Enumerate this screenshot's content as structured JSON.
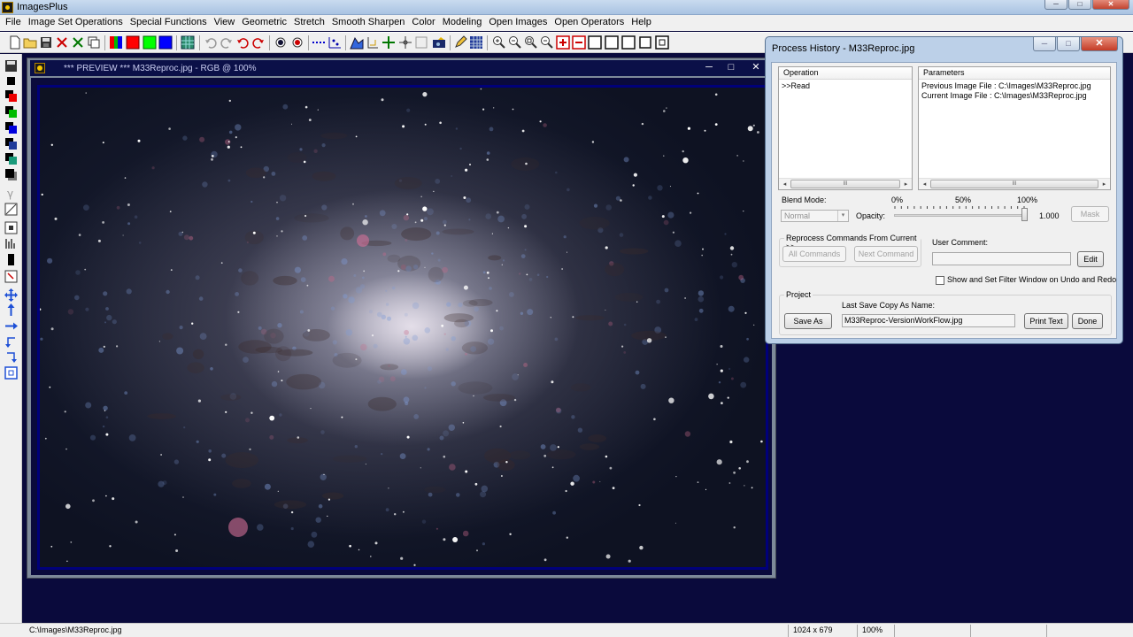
{
  "app": {
    "title": "ImagesPlus"
  },
  "window_buttons": {
    "minimize": "─",
    "maximize": "□",
    "close": "✕"
  },
  "menu": [
    "File",
    "Image Set Operations",
    "Special Functions",
    "View",
    "Geometric",
    "Stretch",
    "Smooth Sharpen",
    "Color",
    "Modeling",
    "Open Images",
    "Open Operators",
    "Help"
  ],
  "toolbar_icons": [
    "new-icon",
    "open-icon",
    "save-icon",
    "close-image-icon",
    "close-all-icon",
    "copy-icon",
    "rgb-channels-icon",
    "red-channel-icon",
    "green-channel-icon",
    "blue-channel-icon",
    "grid-icon",
    "undo-icon",
    "redo-icon",
    "undo-red-icon",
    "redo-red-icon",
    "point-icon",
    "point-red-icon",
    "dotted-line-icon",
    "plot-icon",
    "histogram-icon",
    "axes-icon",
    "crosshair-icon",
    "star-icon",
    "camera-icon",
    "pencil-icon",
    "table-icon",
    "zoom-in-icon",
    "zoom-out-icon",
    "zoom-fit-icon",
    "zoom-actual-icon",
    "plus-box-icon",
    "minus-box-icon",
    "box1-icon",
    "box2-icon",
    "box3-icon",
    "box4-icon",
    "box5-icon"
  ],
  "left_toolbar_icons": [
    "save-icon",
    "black-swatch-icon",
    "red-swatch-icon",
    "green-swatch-icon",
    "blue-swatch-icon",
    "dark-blue-swatch-icon",
    "teal-swatch-icon",
    "shadow-swatch-icon",
    "gamma-icon",
    "curve-icon",
    "frame-icon",
    "levels-icon",
    "bar-icon",
    "crop-icon",
    "move-icon",
    "arrow-up-icon",
    "arrow-right-icon",
    "rotate-left-icon",
    "rotate-right-icon",
    "fit-icon"
  ],
  "preview": {
    "title": "*** PREVIEW *** M33Reproc.jpg - RGB @ 100%",
    "btn_min": "─",
    "btn_max": "□",
    "btn_close": "✕"
  },
  "dialog": {
    "title": "Process History - M33Reproc.jpg",
    "operation_header": "Operation",
    "operations": [
      ">>Read"
    ],
    "parameters_header": "Parameters",
    "parameters": [
      "Previous Image File : C:\\Images\\M33Reproc.jpg",
      "Current Image File : C:\\Images\\M33Reproc.jpg"
    ],
    "scroll_left": "◂",
    "scroll_right": "▸",
    "scroll_grip": "III",
    "blend_mode_label": "Blend Mode:",
    "blend_mode_value": "Normal",
    "combo_arrow": "▾",
    "opacity_label": "Opacity:",
    "opacity_0": "0%",
    "opacity_50": "50%",
    "opacity_100": "100%",
    "opacity_value": "1.000",
    "opacity_fraction": 1.0,
    "mask_button": "Mask",
    "reprocess_group": "Reprocess Commands From Current >>",
    "all_commands": "All Commands",
    "next_command": "Next Command",
    "user_comment_label": "User Comment:",
    "user_comment_value": "",
    "edit_button": "Edit",
    "show_filter_label": "Show and Set Filter Window on Undo and Redo",
    "project_group": "Project",
    "last_save_label": "Last Save Copy As Name:",
    "save_as_button": "Save As",
    "last_save_value": "M33Reproc-VersionWorkFlow.jpg",
    "print_text_button": "Print Text",
    "done_button": "Done"
  },
  "status": {
    "path": "C:\\Images\\M33Reproc.jpg",
    "dimensions": "1024 x 679",
    "zoom": "100%"
  }
}
